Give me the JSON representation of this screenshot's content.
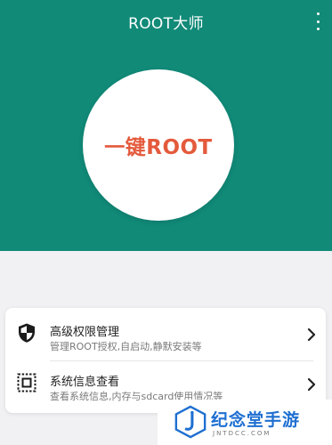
{
  "appbar": {
    "title": "ROOT大师",
    "menu_icon": "more-vert-icon"
  },
  "hero": {
    "root_button_label": "一键ROOT"
  },
  "colors": {
    "primary": "#118a78",
    "accent": "#e45a3c",
    "watermark": "#1e6fd1"
  },
  "features": [
    {
      "icon": "shield-icon",
      "title": "高级权限管理",
      "subtitle": "管理ROOT授权,自启动,静默安装等"
    },
    {
      "icon": "system-info-icon",
      "title": "系统信息查看",
      "subtitle": "查看系统信息,内存与sdcard使用情况等"
    }
  ],
  "watermark": {
    "brand": "纪念堂手游",
    "domain": "JNTDCC.COM"
  }
}
